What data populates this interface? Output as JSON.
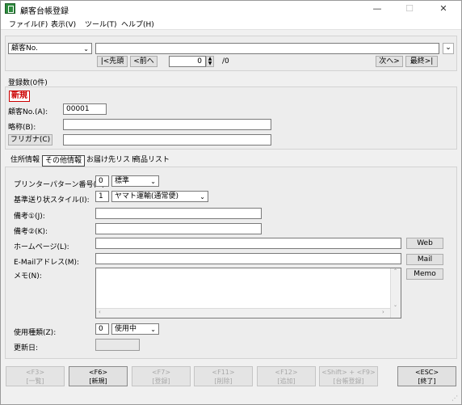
{
  "window": {
    "title": "顧客台帳登録",
    "minimize": "—",
    "maximize": "☐",
    "close": "✕"
  },
  "menu": [
    "ファイル(F)",
    "表示(V)",
    "ツール(T)",
    "ヘルプ(H)"
  ],
  "search": {
    "field_select": "顧客No.",
    "value": "",
    "nav_first": "|<先頭",
    "nav_prev": "<前へ",
    "record_index": "0",
    "record_total": "/0",
    "nav_next": "次へ>",
    "nav_last": "最終>|"
  },
  "record_count": "登録数(0件)",
  "customer": {
    "status_badge": "新規",
    "no_label": "顧客No.(A):",
    "no_value": "00001",
    "short_label": "略称(B):",
    "short_value": "",
    "furigana_label": "フリガナ(C)",
    "furigana_value": ""
  },
  "tabs": [
    "住所情報",
    "その他情報",
    "お届け先リスト",
    "商品リスト"
  ],
  "other": {
    "printer_label": "プリンターパターン番号(G):",
    "printer_no": "0",
    "printer_value": "標準",
    "shipping_label": "基準送り状スタイル(I):",
    "shipping_no": "1",
    "shipping_value": "ヤマト運輸(通常便)",
    "note1_label": "備考①(J):",
    "note1_value": "",
    "note2_label": "備考②(K):",
    "note2_value": "",
    "homepage_label": "ホームページ(L):",
    "homepage_value": "",
    "web_button": "Web",
    "email_label": "E-Mailアドレス(M):",
    "email_value": "",
    "mail_button": "Mail",
    "memo_label": "メモ(N):",
    "memo_value": "",
    "memo_button": "Memo",
    "usage_label": "使用種類(Z):",
    "usage_no": "0",
    "usage_value": "使用中",
    "updated_label": "更新日:",
    "updated_value": ""
  },
  "fkeys": [
    {
      "key": "<F3>",
      "label": "[一覧]",
      "enabled": false
    },
    {
      "key": "<F6>",
      "label": "[新規]",
      "enabled": true
    },
    {
      "key": "<F7>",
      "label": "[登録]",
      "enabled": false
    },
    {
      "key": "<F11>",
      "label": "[削除]",
      "enabled": false
    },
    {
      "key": "<F12>",
      "label": "[追加]",
      "enabled": false
    },
    {
      "key": "<Shift> + <F9>",
      "label": "[台帳登録]",
      "enabled": false
    },
    {
      "key": "<ESC>",
      "label": "[終了]",
      "enabled": true
    }
  ]
}
